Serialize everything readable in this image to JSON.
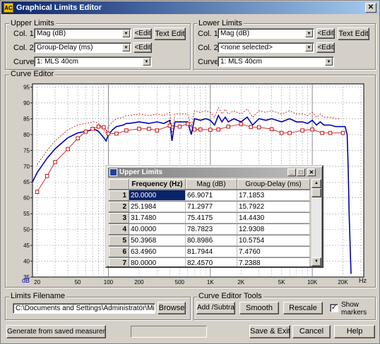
{
  "window": {
    "title": "Graphical Limits Editor",
    "app_badge": "AC",
    "close_glyph": "✕"
  },
  "upper": {
    "title": "Upper Limits",
    "col1_label": "Col. 1",
    "col1_value": "Mag (dB)",
    "col2_label": "Col. 2",
    "col2_value": "Group-Delay (ms)",
    "curve_label": "Curve",
    "curve_value": "1: MLS 40cm",
    "edit_label": "<Edit",
    "text_edit_label": "Text Edit"
  },
  "lower": {
    "title": "Lower Limits",
    "col1_label": "Col. 1",
    "col1_value": "Mag (dB)",
    "col2_label": "Col. 2",
    "col2_value": "<none selected>",
    "curve_label": "Curve",
    "curve_value": "1: MLS 40cm",
    "edit_label": "<Edit",
    "text_edit_label": "Text Edit"
  },
  "curve_editor": {
    "title": "Curve Editor",
    "y_unit": "dB",
    "x_unit": "Hz",
    "y_ticks": [
      "95",
      "90",
      "85",
      "80",
      "75",
      "70",
      "65",
      "60",
      "55",
      "50",
      "45",
      "40",
      "35"
    ],
    "x_ticks": [
      "20",
      "50",
      "100",
      "200",
      "500",
      "1K",
      "2K",
      "5K",
      "10K",
      "20K"
    ],
    "colors": {
      "measurement": "#0000b0",
      "limit": "#c00000",
      "grid": "#a0a0a0"
    }
  },
  "chart_data": {
    "type": "line",
    "xlabel": "Hz",
    "ylabel": "dB",
    "x_scale": "log",
    "xlim": [
      18,
      32000
    ],
    "ylim": [
      35,
      96
    ],
    "series": [
      {
        "name": "measurement",
        "x": [
          18,
          20,
          25,
          30,
          40,
          50,
          60,
          70,
          75,
          80,
          85,
          90,
          95,
          100,
          110,
          120,
          140,
          150,
          160,
          200,
          250,
          300,
          350,
          400,
          420,
          450,
          500,
          550,
          600,
          650,
          700,
          800,
          900,
          1000,
          1100,
          1200,
          1300,
          1400,
          1500,
          1700,
          2000,
          2300,
          2600,
          3000,
          3500,
          4000,
          5000,
          6000,
          7000,
          8000,
          9000,
          10000,
          11000,
          12000,
          13000,
          15000,
          17000,
          19000,
          21000,
          22000,
          22500,
          23000,
          24000
        ],
        "y": [
          65,
          68,
          72.5,
          75.5,
          79,
          80.5,
          81,
          81.5,
          81.5,
          81,
          80,
          79,
          78,
          80,
          81.5,
          82.5,
          83,
          83.5,
          83.5,
          84,
          83.5,
          84,
          83.5,
          84.5,
          78,
          84,
          84,
          84,
          84,
          80,
          85,
          84.5,
          85,
          84.5,
          83,
          86,
          84,
          85.5,
          84,
          85,
          84,
          85.5,
          83,
          85,
          84.5,
          85,
          84,
          85,
          84,
          84,
          83.5,
          84.5,
          83,
          84,
          83,
          83,
          82.5,
          82.5,
          82.5,
          80,
          70,
          55,
          36
        ]
      },
      {
        "name": "upper limit",
        "x": [
          20,
          25,
          30,
          40,
          50,
          60,
          70,
          80,
          90,
          100,
          120,
          150,
          200,
          250,
          300,
          400,
          500,
          600,
          700,
          800,
          1000,
          1200,
          1500,
          2000,
          2500,
          3000,
          4000,
          5000,
          6000,
          8000,
          10000,
          12500,
          15000,
          20000
        ],
        "y": [
          61.9,
          66.9,
          71.3,
          75.4,
          78.8,
          80.9,
          81.8,
          82.5,
          82.3,
          80.3,
          80.3,
          81.3,
          81.8,
          81.8,
          81.3,
          82.8,
          82.5,
          83.4,
          81.6,
          81.6,
          81.5,
          81.6,
          82.5,
          83.3,
          82.4,
          82.3,
          81.7,
          80.5,
          80.5,
          81.3,
          81.6,
          80.5,
          80.5,
          80.5
        ]
      }
    ]
  },
  "table": {
    "title": "Upper Limits",
    "headers": [
      "",
      "Frequency (Hz)",
      "Mag (dB)",
      "Group-Delay (ms)"
    ],
    "rows": [
      [
        "1",
        "20.0000",
        "66.9071",
        "17.1853"
      ],
      [
        "2",
        "25.1984",
        "71.2977",
        "15.7922"
      ],
      [
        "3",
        "31.7480",
        "75.4175",
        "14.4430"
      ],
      [
        "4",
        "40.0000",
        "78.7823",
        "12.9308"
      ],
      [
        "5",
        "50.3968",
        "80.8986",
        "10.5754"
      ],
      [
        "6",
        "63.4960",
        "81.7944",
        "7.4760"
      ],
      [
        "7",
        "80.0000",
        "82.4570",
        "7.2388"
      ]
    ]
  },
  "limits_filename": {
    "title": "Limits Filename",
    "value": "C:\\Documents and Settings\\Administratör\\Mina doku",
    "browse": "Browse"
  },
  "tools": {
    "title": "Curve Editor Tools",
    "add_subtract": "Add /Subtract",
    "smooth": "Smooth",
    "rescale": "Rescale",
    "show_markers_line1": "Show",
    "show_markers_line2": "markers",
    "show_markers_checked": "✓"
  },
  "bottom": {
    "generate": "Generate from saved measurement",
    "save_exit": "Save & Exit",
    "cancel": "Cancel",
    "help": "Help"
  }
}
